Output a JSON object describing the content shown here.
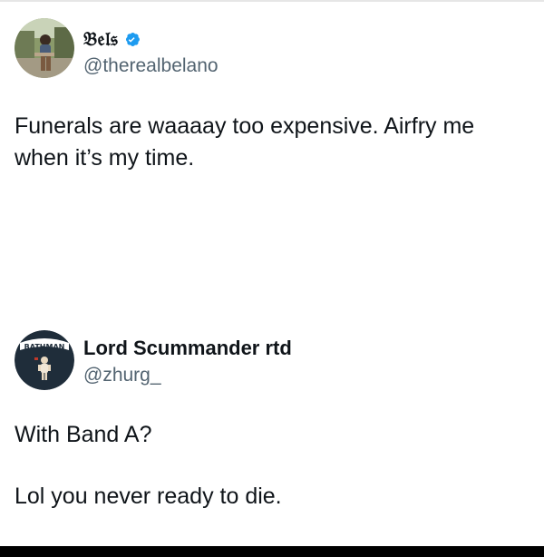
{
  "posts": [
    {
      "author": {
        "display_name": "𝔅𝔢𝔩𝔰",
        "handle": "@therealbelano",
        "verified": true,
        "avatar_icon": "profile-photo-icon"
      },
      "text_lines": [
        "Funerals are waaaay too expensive. Airfry me",
        "when it’s my time."
      ]
    },
    {
      "author": {
        "display_name": "Lord Scummander rtd",
        "handle": "@zhurg_",
        "avatar_icon": "batman-logo-icon",
        "avatar_text": "BATHMAN"
      },
      "text_paragraphs": [
        "With Band A?",
        "Lol you never ready to die."
      ]
    }
  ],
  "colors": {
    "text": "#0f1419",
    "secondary_text": "#536471",
    "verified_blue": "#1d9bf0",
    "avatar2_bg": "#1f2d3a"
  }
}
